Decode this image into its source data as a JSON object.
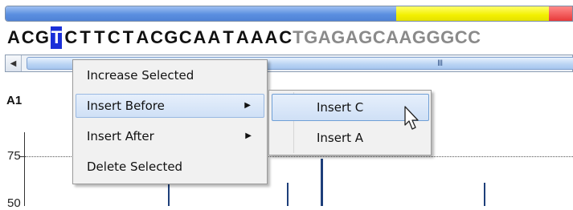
{
  "quality_bar": {
    "colors": {
      "high": "#5b8fe0",
      "medium": "#f3f000",
      "low": "#e83a3a"
    }
  },
  "sequence": {
    "before_selected": [
      "A",
      "C",
      "G"
    ],
    "selected": "T",
    "after_selected": [
      "C",
      "T",
      "T",
      "C",
      "T",
      "A",
      "C",
      "G",
      "C",
      "A",
      "A",
      "T",
      "A",
      "A",
      "A",
      "C"
    ],
    "faded_tail": "TGAGAGCAAGGGCC",
    "selection_color": "#1a2fd8"
  },
  "scrollbar": {
    "left_arrow_icon": "arrow-left-icon",
    "grip": "III"
  },
  "trace": {
    "label": "A1",
    "y_labels": [
      "75",
      "50"
    ]
  },
  "context_menu": {
    "items": [
      {
        "label": "Increase Selected",
        "has_submenu": false
      },
      {
        "label": "Insert Before",
        "has_submenu": true,
        "highlighted": true
      },
      {
        "label": "Insert After",
        "has_submenu": true
      },
      {
        "label": "Delete Selected",
        "has_submenu": false
      }
    ],
    "submenu_arrow": "▶"
  },
  "submenu": {
    "items": [
      {
        "label": "Insert C",
        "highlighted": true
      },
      {
        "label": "Insert A"
      }
    ]
  },
  "cursor_icon": "mouse-pointer-icon"
}
